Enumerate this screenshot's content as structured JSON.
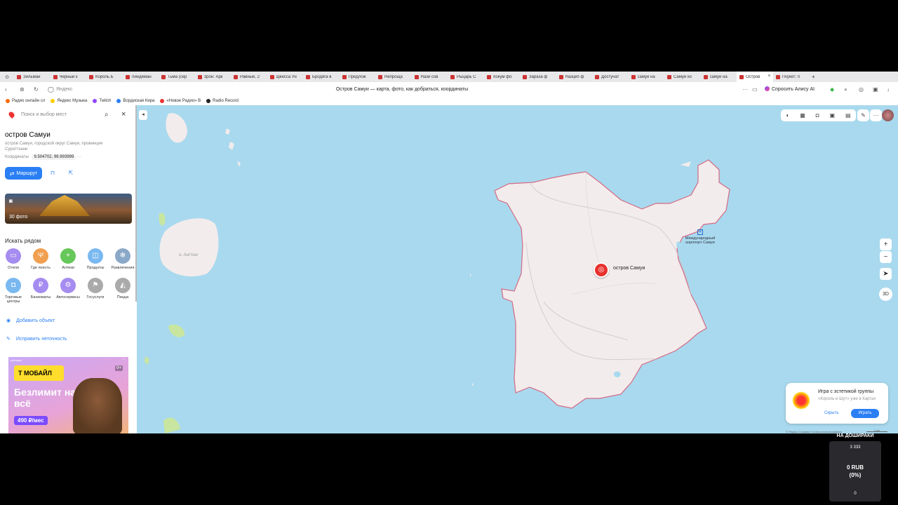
{
  "browser": {
    "tabs": [
      {
        "label": "Зильман"
      },
      {
        "label": "Черный к"
      },
      {
        "label": "Король Б"
      },
      {
        "label": "Линдеман"
      },
      {
        "label": "Тьма (сер"
      },
      {
        "label": "Зрон: Арк"
      },
      {
        "label": "Равные, 2"
      },
      {
        "label": "Джесса Ун"
      },
      {
        "label": "Бродяга в"
      },
      {
        "label": "Предлож"
      },
      {
        "label": "Непроща"
      },
      {
        "label": "Нази сов"
      },
      {
        "label": "Рыцарь С"
      },
      {
        "label": "Хокум фо"
      },
      {
        "label": "Зараза ф"
      },
      {
        "label": "Назцеп ф"
      },
      {
        "label": "Достучат"
      },
      {
        "label": "самуи на"
      },
      {
        "label": "Самуи ко"
      },
      {
        "label": "самуи на"
      },
      {
        "label": "Остров"
      },
      {
        "label": "Пхукет: п"
      }
    ],
    "new_tab": "+",
    "address": {
      "domain": "Яндекс",
      "page_title": "Остров Самуи — карта, фото, как добраться, координаты"
    },
    "alice_label": "Спросить Алису AI",
    "bookmarks": [
      {
        "label": "Радио онлайн сл",
        "color": "#ff6a00"
      },
      {
        "label": "Яндекс Музыка",
        "color": "#ffcc00"
      },
      {
        "label": "Twitch",
        "color": "#9146ff"
      },
      {
        "label": "Вордиская Кира",
        "color": "#2a7ff5"
      },
      {
        "label": "«Новое Радио» В",
        "color": "#e33"
      },
      {
        "label": "Radio Record",
        "color": "#222"
      }
    ]
  },
  "sidebar": {
    "search_placeholder": "Поиск и выбор мест",
    "place_title": "остров Самуи",
    "place_subtitle": "остров Самуи, городской округ Самуи, провинция Сураттхани",
    "coords_label": "Координаты",
    "coords_value": "9.504702, 99.993999",
    "coords_more": "···",
    "route_label": "Маршрут",
    "photo_count": "30 фото",
    "nearby_title": "Искать рядом",
    "categories": [
      {
        "label": "Отели",
        "icon": "bed-icon",
        "color": "#a48cf0",
        "glyph": "▭"
      },
      {
        "label": "Где поесть",
        "icon": "fork-knife-icon",
        "color": "#f0a050",
        "glyph": "Ψ"
      },
      {
        "label": "Аптеки",
        "icon": "pharmacy-cross-icon",
        "color": "#66c75a",
        "glyph": "+"
      },
      {
        "label": "Продукты",
        "icon": "basket-icon",
        "color": "#7ab8f0",
        "glyph": "◫"
      },
      {
        "label": "Развлечения",
        "icon": "ferris-wheel-icon",
        "color": "#8aa8c8",
        "glyph": "✻"
      },
      {
        "label": "Торговые центры",
        "icon": "shopping-bag-icon",
        "color": "#7ab8f0",
        "glyph": "◘"
      },
      {
        "label": "Банкоматы",
        "icon": "ruble-icon",
        "color": "#a48cf0",
        "glyph": "₽"
      },
      {
        "label": "Автосервисы",
        "icon": "car-service-icon",
        "color": "#a48cf0",
        "glyph": "⚙"
      },
      {
        "label": "Госуслуги",
        "icon": "flag-icon",
        "color": "#aaaaaa",
        "glyph": "⚑"
      },
      {
        "label": "Пицца",
        "icon": "pizza-icon",
        "color": "#aaaaaa",
        "glyph": "◭"
      }
    ],
    "add_object": "Добавить объект",
    "fix_error": "Исправить неточность",
    "ad": {
      "mark": "реклама",
      "badge": "Т МОБАЙЛ",
      "headline": "Безлимит на всё",
      "price": "490 ₽/мес",
      "age": "0+"
    }
  },
  "map": {
    "marker_label": "остров Самуи",
    "airport_label": "Международный аэропорт Самуи",
    "island_label": "о. Ангтонг",
    "zoom_in": "+",
    "zoom_out": "−",
    "btn_3d": "3D",
    "popup": {
      "title": "Игра с эстетикой группы",
      "subtitle": "«Король и Шут» уже в Картах",
      "hide": "Скрыть",
      "play": "Играть"
    },
    "copyright": "© Яндекс   Справка   Условия использования",
    "scale": "2 км"
  },
  "overlay": {
    "title": "НА ДОШИРАКИ",
    "top": "3 333",
    "amount": "0 RUB",
    "percent": "(0%)",
    "bottom": "0"
  }
}
